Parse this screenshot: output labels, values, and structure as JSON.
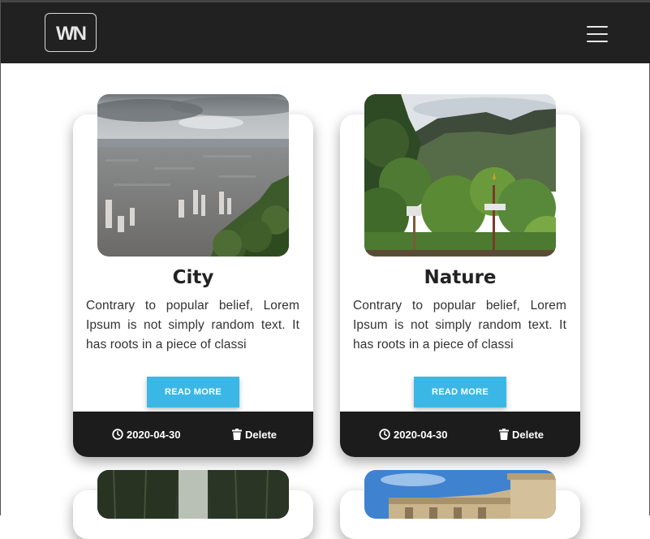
{
  "navbar": {
    "logo_text": "WN",
    "menu_icon": "hamburger-icon"
  },
  "cards": [
    {
      "title": "City",
      "text": "Contrary to popular belief, Lorem Ipsum is not simply random text. It has roots in a piece of classi",
      "button": "READ MORE",
      "date": "2020-04-30",
      "delete": "Delete"
    },
    {
      "title": "Nature",
      "text": "Contrary to popular belief, Lorem Ipsum is not simply random text. It has roots in a piece of classi",
      "button": "READ MORE",
      "date": "2020-04-30",
      "delete": "Delete"
    }
  ],
  "colors": {
    "navbar": "#212121",
    "button": "#3bb7e6",
    "footer": "#1c1c1c"
  }
}
